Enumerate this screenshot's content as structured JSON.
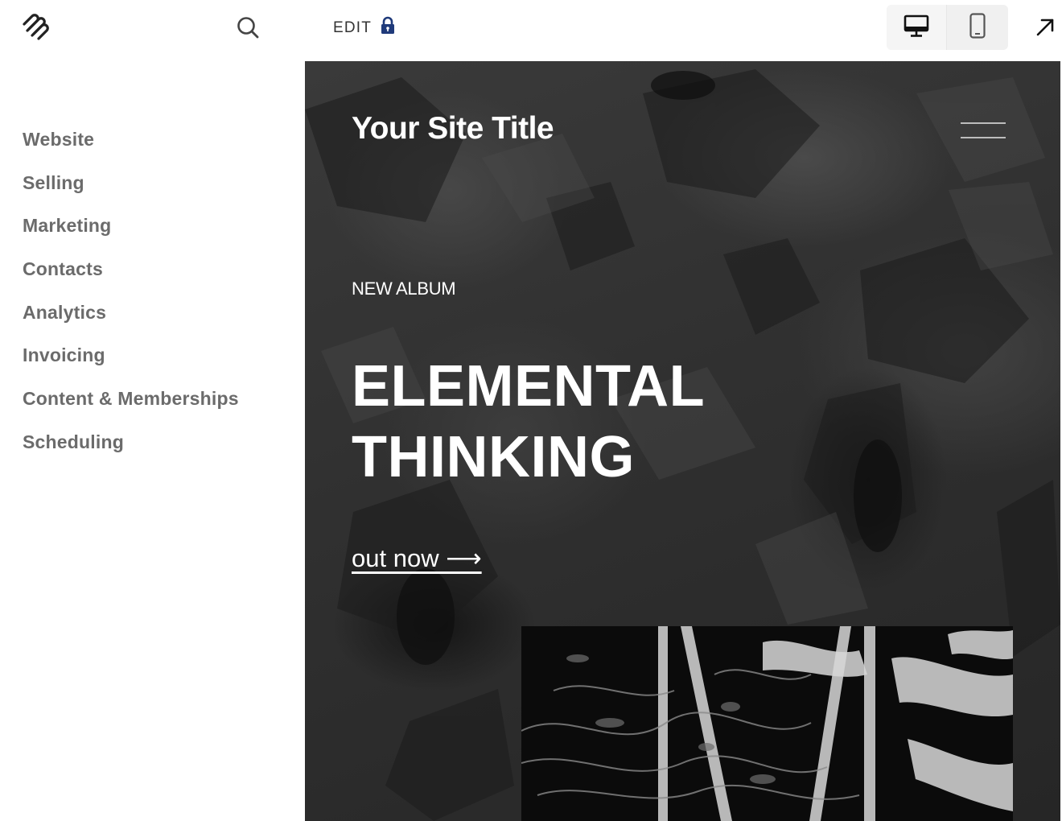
{
  "sidebar": {
    "logo_icon": "squarespace-logo-icon",
    "search_icon": "search-icon",
    "items": [
      {
        "label": "Website"
      },
      {
        "label": "Selling"
      },
      {
        "label": "Marketing"
      },
      {
        "label": "Contacts"
      },
      {
        "label": "Analytics"
      },
      {
        "label": "Invoicing"
      },
      {
        "label": "Content & Memberships"
      },
      {
        "label": "Scheduling"
      }
    ]
  },
  "topbar": {
    "edit_label": "EDIT",
    "lock_icon": "lock-icon",
    "lock_color": "#1f3a7a",
    "devices": [
      {
        "icon": "desktop-icon",
        "active": true
      },
      {
        "icon": "mobile-icon",
        "active": false
      }
    ],
    "open_icon": "arrow-up-right-icon"
  },
  "preview": {
    "site_title": "Your Site Title",
    "menu_icon": "hamburger-menu-icon",
    "kicker": "NEW ALBUM",
    "headline_line1": "ELEMENTAL",
    "headline_line2": "THINKING",
    "cta": "out now ⟶"
  }
}
